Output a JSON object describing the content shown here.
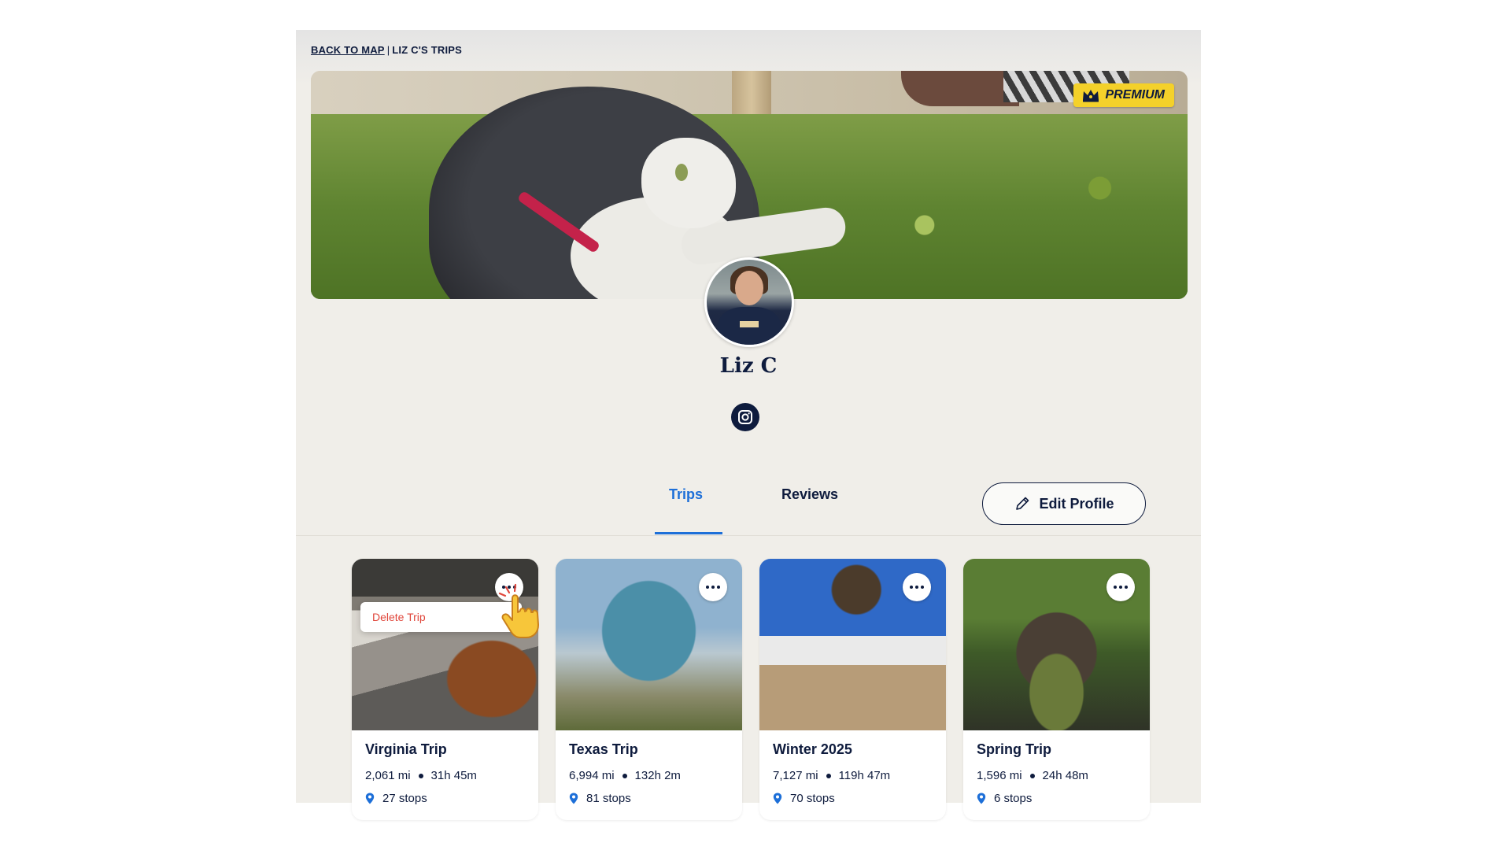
{
  "breadcrumb": {
    "back_link": "BACK TO MAP",
    "separator": "|",
    "current": "LIZ C'S TRIPS"
  },
  "banner": {
    "premium_label": "PREMIUM"
  },
  "profile": {
    "name": "Liz C",
    "social_icon": "instagram-icon"
  },
  "tabs": [
    {
      "label": "Trips",
      "active": true
    },
    {
      "label": "Reviews",
      "active": false
    }
  ],
  "edit_profile": {
    "label": "Edit Profile",
    "icon": "pencil-icon"
  },
  "context_menu": {
    "delete_label": "Delete Trip"
  },
  "trips": [
    {
      "title": "Virginia Trip",
      "distance": "2,061 mi",
      "duration": "31h 45m",
      "stops": "27 stops"
    },
    {
      "title": "Texas Trip",
      "distance": "6,994 mi",
      "duration": "132h 2m",
      "stops": "81 stops"
    },
    {
      "title": "Winter 2025",
      "distance": "7,127 mi",
      "duration": "119h 47m",
      "stops": "70 stops"
    },
    {
      "title": "Spring Trip",
      "distance": "1,596 mi",
      "duration": "24h 48m",
      "stops": "6 stops"
    }
  ],
  "colors": {
    "accent": "#1d6fd8",
    "navy": "#0e1b3d",
    "premium": "#f4d12a",
    "danger": "#e0463b",
    "panel": "#f0eee9"
  }
}
